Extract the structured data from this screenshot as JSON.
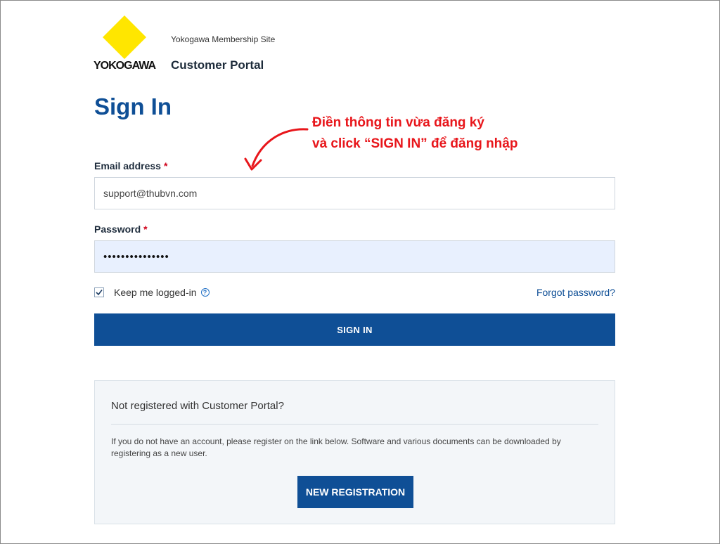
{
  "header": {
    "logo_text": "YOKOGAWA",
    "site_name": "Yokogawa Membership Site",
    "portal_name": "Customer Portal"
  },
  "page_title": "Sign In",
  "annotation": {
    "line1": "Điền thông tin vừa đăng ký",
    "line2": "và click “SIGN IN” để đăng nhập"
  },
  "form": {
    "email_label": "Email address",
    "required_mark": "*",
    "email_value": "support@thubvn.com",
    "password_label": "Password",
    "password_value": "•••••••••••••••",
    "remember_label": "Keep me logged-in",
    "remember_checked": true,
    "forgot_link": "Forgot password?",
    "signin_button": "SIGN IN"
  },
  "registration": {
    "title": "Not registered with Customer Portal?",
    "text": "If you do not have an account, please register on the link below. Software and various documents can be downloaded by registering as a new user.",
    "button": "NEW REGISTRATION"
  },
  "colors": {
    "brand_blue": "#0f4f96",
    "logo_yellow": "#ffe600",
    "annotation_red": "#e8161b"
  },
  "icons": [
    "yokogawa-logo",
    "checkmark-icon",
    "info-icon",
    "arrow-annotation-icon"
  ]
}
